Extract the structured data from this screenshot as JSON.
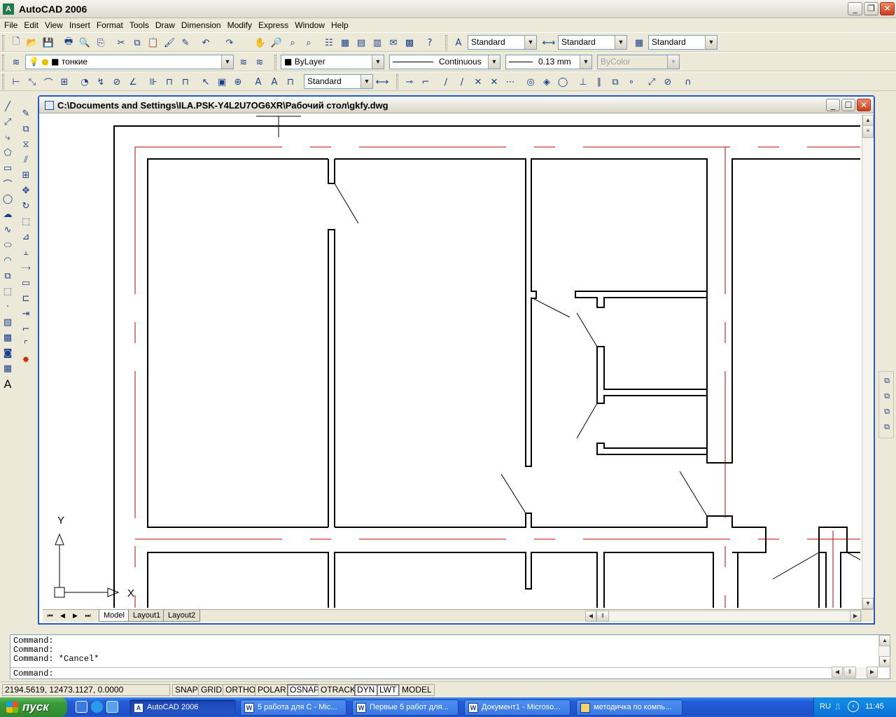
{
  "window": {
    "title": "AutoCAD 2006"
  },
  "menu": [
    "File",
    "Edit",
    "View",
    "Insert",
    "Format",
    "Tools",
    "Draw",
    "Dimension",
    "Modify",
    "Express",
    "Window",
    "Help"
  ],
  "styles_toolbar": {
    "text_style": "Standard",
    "dim_style": "Standard",
    "table_style": "Standard"
  },
  "layers_toolbar": {
    "current_layer": "тонкие"
  },
  "properties_toolbar": {
    "color": "ByLayer",
    "linetype": "Continuous",
    "lineweight": "0.13 mm",
    "plot_style": "ByColor"
  },
  "dimension_toolbar": {
    "dim_style": "Standard"
  },
  "document": {
    "path": "C:\\Documents and Settings\\ILA.PSK-Y4L2U7OG6XR\\Рабочий стол\\gkfy.dwg"
  },
  "ucs": {
    "x_label": "X",
    "y_label": "Y"
  },
  "tabs": [
    "Model",
    "Layout1",
    "Layout2"
  ],
  "command": {
    "history": [
      "Command:",
      "Command:",
      "Command: *Cancel*"
    ],
    "prompt": "Command:"
  },
  "status": {
    "coords": "2194.5619, 12473.1127, 0.0000",
    "toggles": [
      "SNAP",
      "GRID",
      "ORTHO",
      "POLAR",
      "OSNAP",
      "OTRACK",
      "DYN",
      "LWT",
      "MODEL"
    ],
    "on": [
      "OSNAP",
      "DYN",
      "LWT"
    ]
  },
  "taskbar": {
    "start": "пуск",
    "tasks": [
      "AutoCAD 2006",
      "5 работа для С - Mic...",
      "Первые 5 работ для...",
      "Документ1 - Microso...",
      "методичка по компь..."
    ],
    "lang": "RU",
    "clock": "11:45"
  },
  "colors": {
    "axis_red": "#cc0000",
    "title_blue": "#2559c9",
    "taskbar_blue": "#245edb"
  }
}
